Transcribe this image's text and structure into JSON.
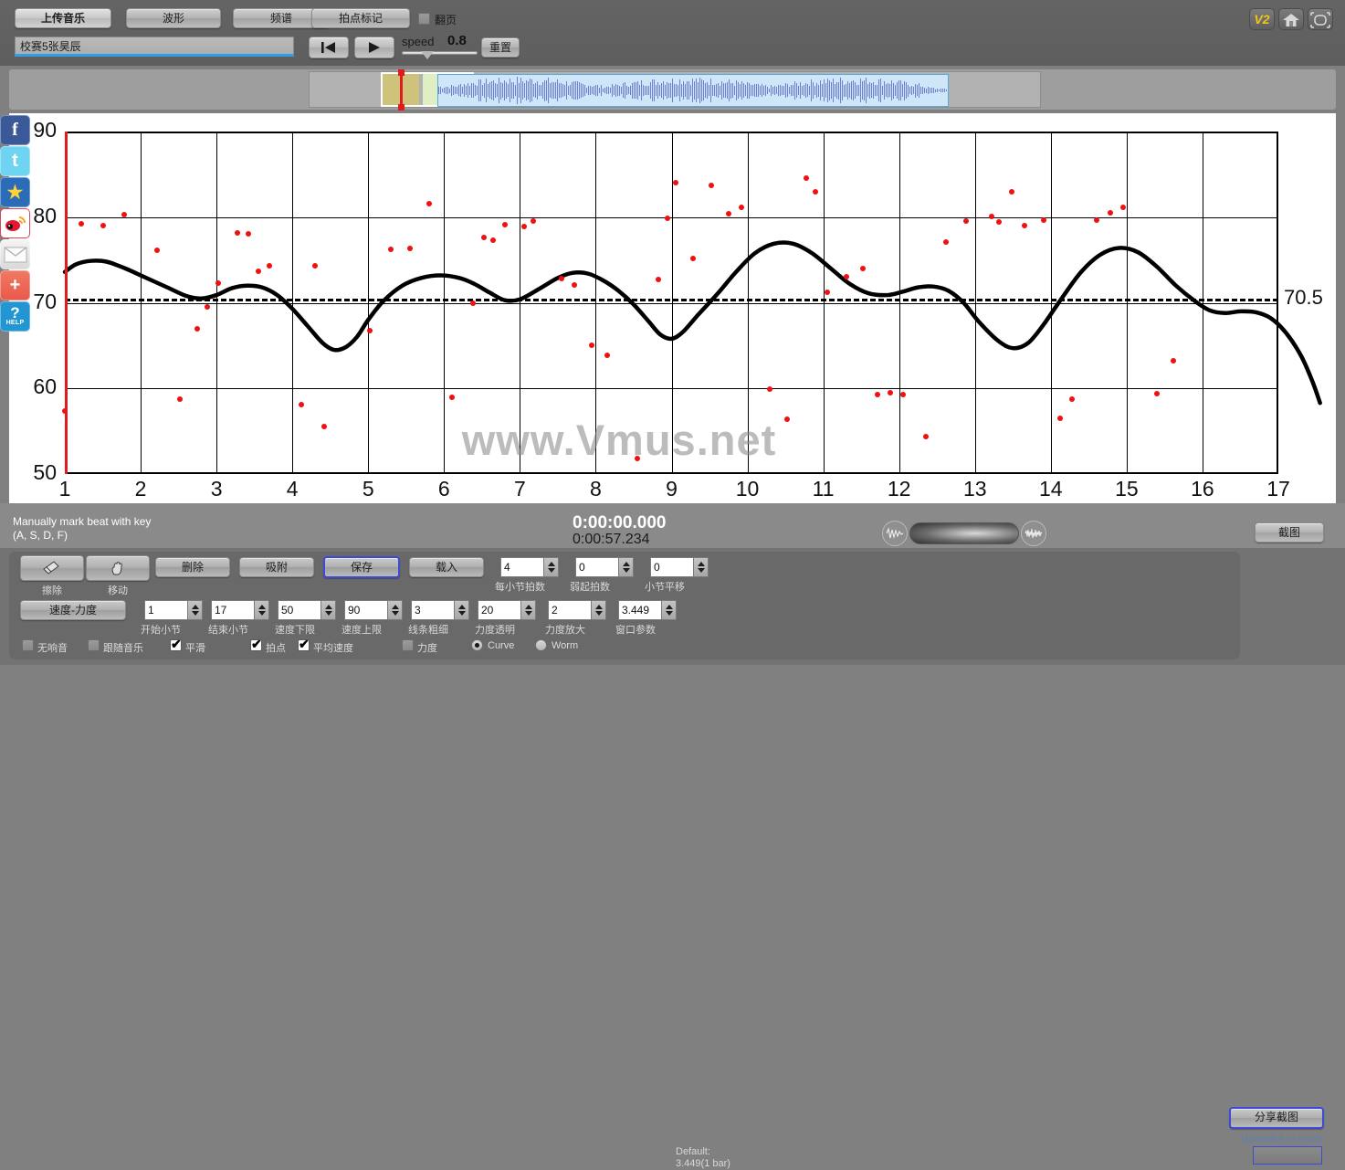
{
  "toolbar": {
    "upload_music": "上传音乐",
    "waveform": "波形",
    "spectrum": "频谱",
    "beat_mark": "拍点标记",
    "page_turn_label": "翻页",
    "page_turn_checked": false,
    "song_title": "校赛5张昊辰",
    "speed_label": "speed",
    "speed_value": "0.8",
    "reset": "重置",
    "v2_badge": "V2",
    "home_icon": "home-icon",
    "fullscreen_icon": "fullscreen-icon",
    "rewind_icon": "rewind-to-start-icon",
    "play_icon": "play-icon"
  },
  "social": [
    {
      "name": "facebook",
      "glyph": "f"
    },
    {
      "name": "twitter",
      "glyph": "t"
    },
    {
      "name": "qzone",
      "glyph": "★"
    },
    {
      "name": "weibo",
      "glyph": "●"
    },
    {
      "name": "email",
      "glyph": "✉"
    },
    {
      "name": "share-plus",
      "glyph": "+"
    },
    {
      "name": "help",
      "glyph": "?",
      "caption": "HELP"
    }
  ],
  "chart_data": {
    "type": "line",
    "title": "",
    "xlabel": "",
    "ylabel": "",
    "xlim": [
      1,
      17
    ],
    "ylim": [
      50,
      90
    ],
    "yticks": [
      50,
      60,
      70,
      80,
      90
    ],
    "xticks": [
      1,
      2,
      3,
      4,
      5,
      6,
      7,
      8,
      9,
      10,
      11,
      12,
      13,
      14,
      15,
      16,
      17
    ],
    "grid": true,
    "average_line": {
      "value": 70.5,
      "label": "70.5",
      "style": "dashed"
    },
    "watermark": "www.Vmus.net",
    "series": [
      {
        "name": "tempo-curve",
        "type": "line",
        "color": "#000000",
        "points": [
          [
            1.0,
            73.6
          ],
          [
            1.15,
            74.5
          ],
          [
            1.35,
            74.9
          ],
          [
            1.55,
            74.8
          ],
          [
            1.8,
            74.0
          ],
          [
            2.05,
            73.0
          ],
          [
            2.35,
            71.8
          ],
          [
            2.6,
            70.8
          ],
          [
            2.8,
            70.5
          ],
          [
            3.0,
            70.9
          ],
          [
            3.2,
            71.7
          ],
          [
            3.4,
            72.0
          ],
          [
            3.6,
            71.8
          ],
          [
            3.8,
            70.9
          ],
          [
            4.0,
            69.3
          ],
          [
            4.2,
            67.3
          ],
          [
            4.4,
            65.3
          ],
          [
            4.55,
            64.5
          ],
          [
            4.7,
            64.8
          ],
          [
            4.85,
            66.0
          ],
          [
            5.0,
            68.0
          ],
          [
            5.2,
            70.2
          ],
          [
            5.45,
            72.0
          ],
          [
            5.7,
            72.9
          ],
          [
            5.95,
            73.2
          ],
          [
            6.2,
            72.9
          ],
          [
            6.4,
            72.2
          ],
          [
            6.6,
            71.2
          ],
          [
            6.8,
            70.3
          ],
          [
            7.0,
            70.4
          ],
          [
            7.25,
            71.6
          ],
          [
            7.5,
            72.9
          ],
          [
            7.7,
            73.5
          ],
          [
            7.9,
            73.4
          ],
          [
            8.1,
            72.6
          ],
          [
            8.3,
            71.4
          ],
          [
            8.5,
            69.8
          ],
          [
            8.7,
            67.8
          ],
          [
            8.85,
            66.3
          ],
          [
            9.0,
            65.8
          ],
          [
            9.15,
            66.6
          ],
          [
            9.35,
            68.6
          ],
          [
            9.6,
            71.0
          ],
          [
            9.85,
            73.6
          ],
          [
            10.1,
            75.8
          ],
          [
            10.35,
            76.9
          ],
          [
            10.6,
            76.9
          ],
          [
            10.85,
            75.8
          ],
          [
            11.1,
            74.0
          ],
          [
            11.35,
            72.2
          ],
          [
            11.6,
            71.1
          ],
          [
            11.85,
            70.9
          ],
          [
            12.05,
            71.3
          ],
          [
            12.25,
            71.8
          ],
          [
            12.45,
            71.9
          ],
          [
            12.65,
            71.4
          ],
          [
            12.85,
            70.0
          ],
          [
            13.05,
            67.8
          ],
          [
            13.3,
            65.6
          ],
          [
            13.5,
            64.7
          ],
          [
            13.7,
            65.3
          ],
          [
            13.9,
            67.4
          ],
          [
            14.15,
            70.6
          ],
          [
            14.4,
            73.6
          ],
          [
            14.65,
            75.6
          ],
          [
            14.9,
            76.4
          ],
          [
            15.15,
            75.9
          ],
          [
            15.4,
            74.2
          ],
          [
            15.65,
            72.0
          ],
          [
            15.9,
            70.2
          ],
          [
            16.1,
            69.1
          ],
          [
            16.3,
            68.8
          ],
          [
            16.5,
            69.0
          ],
          [
            16.7,
            68.9
          ],
          [
            16.9,
            68.2
          ],
          [
            17.1,
            66.5
          ],
          [
            17.3,
            63.8
          ],
          [
            17.45,
            60.8
          ],
          [
            17.55,
            58.3
          ]
        ]
      },
      {
        "name": "beat-points",
        "type": "scatter",
        "color": "#f01010",
        "points": [
          [
            1.0,
            57.4
          ],
          [
            1.22,
            79.2
          ],
          [
            1.5,
            79.0
          ],
          [
            1.78,
            80.3
          ],
          [
            2.22,
            76.1
          ],
          [
            2.52,
            58.8
          ],
          [
            2.75,
            67.0
          ],
          [
            3.02,
            72.3
          ],
          [
            3.28,
            78.2
          ],
          [
            3.42,
            78.1
          ],
          [
            3.55,
            73.7
          ],
          [
            3.7,
            74.3
          ],
          [
            4.12,
            58.1
          ],
          [
            4.3,
            74.3
          ],
          [
            4.42,
            55.5
          ],
          [
            5.02,
            66.8
          ],
          [
            5.3,
            76.2
          ],
          [
            5.55,
            76.3
          ],
          [
            5.8,
            81.6
          ],
          [
            6.1,
            59.0
          ],
          [
            6.52,
            77.6
          ],
          [
            6.65,
            77.3
          ],
          [
            6.8,
            79.1
          ],
          [
            7.05,
            78.9
          ],
          [
            7.18,
            79.5
          ],
          [
            7.55,
            72.8
          ],
          [
            7.72,
            72.1
          ],
          [
            7.95,
            65.0
          ],
          [
            8.15,
            63.9
          ],
          [
            8.55,
            51.8
          ],
          [
            8.82,
            72.7
          ],
          [
            9.05,
            84.0
          ],
          [
            9.28,
            75.2
          ],
          [
            9.52,
            83.7
          ],
          [
            9.75,
            80.4
          ],
          [
            9.92,
            81.2
          ],
          [
            10.3,
            59.9
          ],
          [
            10.52,
            56.4
          ],
          [
            10.78,
            84.6
          ],
          [
            10.9,
            83.0
          ],
          [
            11.3,
            73.0
          ],
          [
            11.52,
            74.0
          ],
          [
            11.72,
            59.3
          ],
          [
            11.88,
            59.5
          ],
          [
            12.05,
            59.3
          ],
          [
            12.35,
            54.4
          ],
          [
            12.62,
            77.1
          ],
          [
            12.88,
            79.5
          ],
          [
            13.22,
            80.1
          ],
          [
            13.32,
            79.4
          ],
          [
            13.48,
            83.0
          ],
          [
            13.65,
            79.0
          ],
          [
            13.9,
            79.7
          ],
          [
            14.12,
            56.5
          ],
          [
            14.28,
            58.8
          ],
          [
            14.6,
            79.7
          ],
          [
            14.78,
            80.5
          ],
          [
            14.95,
            81.2
          ],
          [
            15.4,
            59.4
          ],
          [
            15.62,
            63.2
          ],
          [
            8.95,
            79.9
          ],
          [
            2.88,
            69.5
          ],
          [
            6.38,
            70.0
          ],
          [
            11.05,
            71.2
          ]
        ]
      }
    ]
  },
  "status": {
    "hint_line1": "Manually mark beat with key",
    "hint_line2": "(A, S, D, F)",
    "time_current": "0:00:00.000",
    "time_total": "0:00:57.234",
    "zoom_out_icon": "waveform-zoom-out-icon",
    "zoom_in_icon": "waveform-zoom-in-icon",
    "screenshot_button": "截图"
  },
  "controls": {
    "row1_buttons": [
      {
        "name": "erase",
        "caption": "擦除",
        "icon": "eraser-icon"
      },
      {
        "name": "move",
        "caption": "移动",
        "icon": "hand-icon"
      }
    ],
    "delete": "删除",
    "snap": "吸附",
    "save": "保存",
    "load": "载入",
    "tempo_dynamics": "速度-力度",
    "spinners_row1": [
      {
        "name": "beats-per-bar",
        "value": "4",
        "caption": "每小节拍数"
      },
      {
        "name": "pickup-beats",
        "value": "0",
        "caption": "弱起拍数"
      },
      {
        "name": "bar-shift",
        "value": "0",
        "caption": "小节平移"
      }
    ],
    "spinners_row2": [
      {
        "name": "start-bar",
        "value": "1",
        "caption": "开始小节"
      },
      {
        "name": "end-bar",
        "value": "17",
        "caption": "结束小节"
      },
      {
        "name": "tempo-min",
        "value": "50",
        "caption": "速度下限"
      },
      {
        "name": "tempo-max",
        "value": "90",
        "caption": "速度上限"
      },
      {
        "name": "line-thickness",
        "value": "3",
        "caption": "线条粗细"
      },
      {
        "name": "dynamics-opacity",
        "value": "20",
        "caption": "力度透明"
      },
      {
        "name": "dynamics-scale",
        "value": "2",
        "caption": "力度放大"
      },
      {
        "name": "window-param",
        "value": "3.449",
        "caption": "窗口参数"
      }
    ],
    "default_note_line1": "Default:",
    "default_note_line2": "3.449(1 bar)",
    "checkboxes": [
      {
        "name": "no-sound",
        "label": "无响音",
        "checked": false
      },
      {
        "name": "follow-music",
        "label": "跟随音乐",
        "checked": false
      },
      {
        "name": "smooth",
        "label": "平滑",
        "checked": true
      },
      {
        "name": "beats",
        "label": "拍点",
        "checked": true
      },
      {
        "name": "average-tempo",
        "label": "平均速度",
        "checked": true
      },
      {
        "name": "dynamics",
        "label": "力度",
        "checked": false
      }
    ],
    "radios": [
      {
        "name": "curve",
        "label": "Curve",
        "selected": true
      },
      {
        "name": "worm",
        "label": "Worm",
        "selected": false
      }
    ],
    "share_screenshot": "分享截图",
    "uploaded_text": "Uploaded to cloud"
  },
  "colors": {
    "accent_blue": "#3b4bd8",
    "dot_red": "#f01010",
    "curve_black": "#000000",
    "panel_gray": "#737373"
  }
}
